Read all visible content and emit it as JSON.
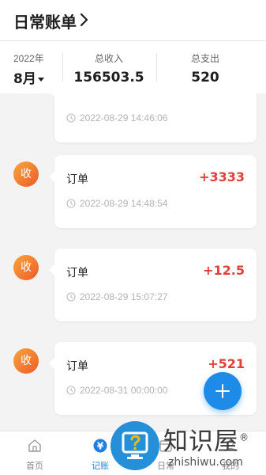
{
  "header": {
    "title": "日常账单"
  },
  "stats": {
    "year": "2022年",
    "month": "8月",
    "income_label": "总收入",
    "income_value": "156503.5",
    "expense_label": "总支出",
    "expense_value": "520"
  },
  "records": [
    {
      "badge": "",
      "title": "",
      "amount": "",
      "time": "2022-08-29 14:46:06"
    },
    {
      "badge": "收",
      "title": "订单",
      "amount": "+3333",
      "time": "2022-08-29 14:48:54"
    },
    {
      "badge": "收",
      "title": "订单",
      "amount": "+12.5",
      "time": "2022-08-29 15:07:27"
    },
    {
      "badge": "收",
      "title": "订单",
      "amount": "+521",
      "time": "2022-08-31 00:00:00"
    }
  ],
  "tabs": [
    {
      "label": "首页",
      "icon": "home-icon"
    },
    {
      "label": "记账",
      "icon": "yen-icon",
      "icon_text": "¥"
    },
    {
      "label": "日常",
      "icon": "calendar-icon"
    },
    {
      "label": "我的",
      "icon": "user-icon"
    }
  ],
  "watermark": {
    "text_cn": "知识屋",
    "text_en": "zhishiwu.com",
    "mark": "®",
    "icon": "monitor-question-icon"
  },
  "colors": {
    "accent": "#1f8be8",
    "income": "#e0403a",
    "badge_start": "#f7a63b",
    "badge_end": "#ee5a2a"
  }
}
